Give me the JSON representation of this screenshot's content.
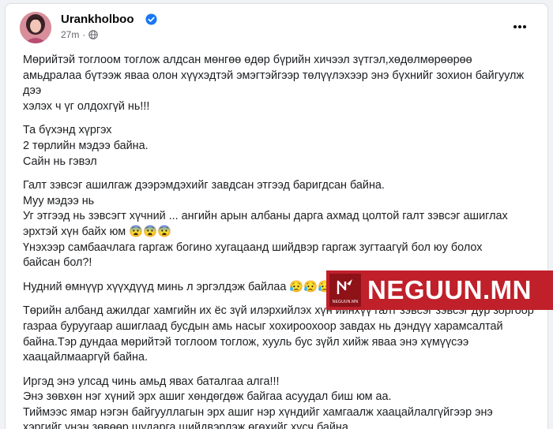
{
  "post": {
    "author": "Urankholboo",
    "time": "27m",
    "separator": "·",
    "paragraphs": [
      [
        "Мөрийтэй тоглоом тоглож алдсан мөнгөө өдөр бүрийн хичээл зүтгэл,хөдөлмөрөөрөө",
        "амьдралаа бүтээж яваа олон хүүхэдтэй эмэгтэйгээр төлүүлэхээр энэ бүхнийг зохион байгуулж",
        "дээ",
        "хэлэх ч үг олдохгүй нь!!!"
      ],
      [
        "Та бүхэнд хүргэх",
        "2 төрлийн мэдээ байна.",
        "Сайн нь гэвэл"
      ],
      [
        "Галт зэвсэг ашилгаж  дээрэмдэхийг завдсан этгээд баригдсан байна.",
        "Муу мэдээ нь",
        "Уг этгээд нь зэвсэгт хүчний ... ангийн арын албаны дарга ахмад цолтой галт зэвсэг ашиглах",
        "эрхтэй хүн байх юм 😨😨😨",
        "Үнэхээр самбаачлага гаргаж богино хугацаанд шийдвэр гаргаж зугтаагүй бол юу болох",
        "байсан бол?!"
      ],
      [
        "Нудний өмнүүр хүүхдүүд минь л эргэлдэж байлаа 😥😥😥"
      ],
      [
        "Төрийн албанд ажилдаг хамгийн их ёс зүй илэрхийлэх хүн ийнхүү галт зэвсэг зэвсэг дур зоргоор",
        "газраа буруугаар ашиглаад бусдын амь насыг хохироохоор завдах нь дэндүү харамсалтай",
        "байна.Тэр дундаа мөрийтэй тоглоом тоглож, хууль бус зүйл хийж яваа энэ хүмүүсээ",
        "хаацайлмааргүй байна."
      ],
      [
        "Иргэд энэ улсад чинь амьд явах баталгаа алга!!!",
        "Энэ зөвхөн нэг хүний эрх ашиг хөндөгдөж байгаа асуудал биш юм аа.",
        "Тиймээс ямар нэгэн байгууллагын эрх ашиг нэр хүндийг хамгаалж хаацайлалгүйгээр энэ",
        "хэргийг үнэн зөвөөр,шударга шийдвэрлэж өгөхийг хүсч байна."
      ]
    ]
  },
  "watermark": {
    "brand": "NEGUUN.MN",
    "logo_caption": "NEGUUN.MN"
  },
  "colors": {
    "verified": "#1877f2",
    "watermark_bg": "#c0202a"
  },
  "icons": {
    "verified": "verified-badge-icon",
    "audience": "globe-icon",
    "more": "more-options-icon"
  }
}
